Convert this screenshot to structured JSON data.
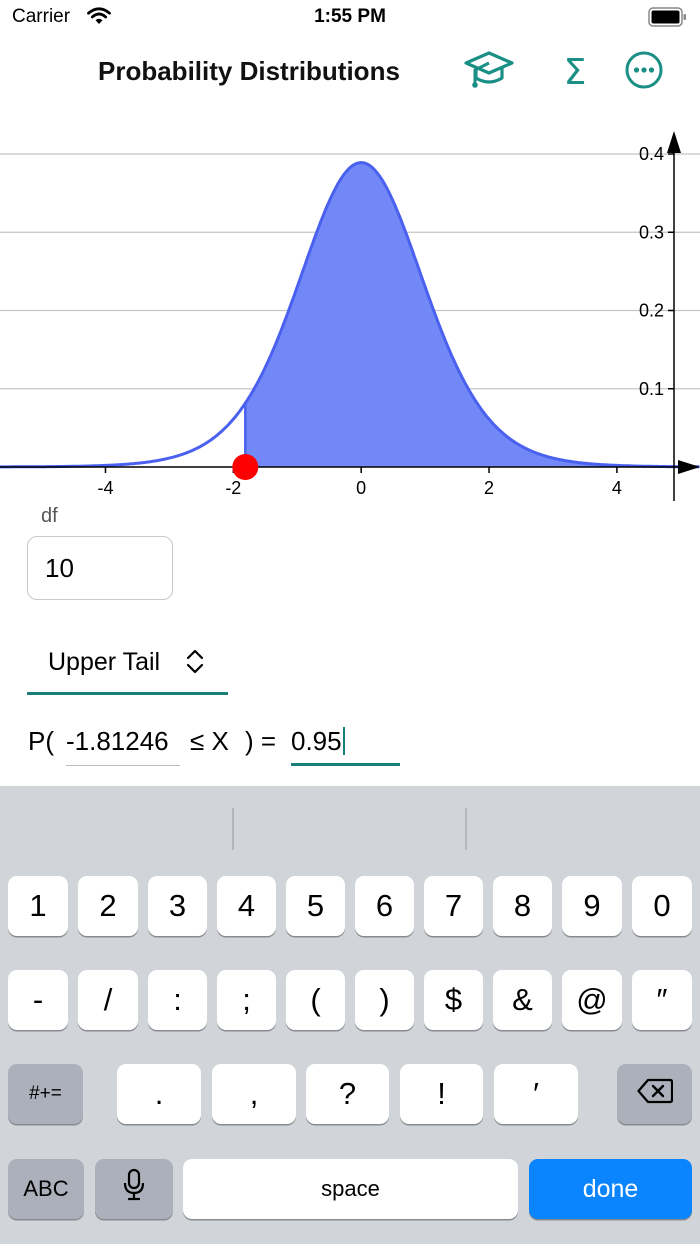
{
  "status_bar": {
    "carrier": "Carrier",
    "time": "1:55 PM"
  },
  "nav": {
    "title": "Probability Distributions",
    "icons": [
      "graduation-cap-icon",
      "sigma-icon",
      "more-icon"
    ],
    "sigma_glyph": "Σ",
    "accent_color": "#1a8f86"
  },
  "chart_data": {
    "type": "area",
    "distribution": "Student's t",
    "x_ticks": [
      "-4",
      "-2",
      "0",
      "2",
      "4"
    ],
    "y_ticks": [
      "0.1",
      "0.2",
      "0.3",
      "0.4"
    ],
    "xlim": [
      -5.65,
      5.3
    ],
    "ylim": [
      0,
      0.4
    ],
    "grid": true,
    "peak": {
      "x": 0,
      "y": 0.389
    },
    "shaded_region": {
      "from": -1.81246,
      "to": "inf"
    },
    "marker": {
      "x": -1.81246,
      "y": 0,
      "color": "#ff0000"
    },
    "fill_color": "#7388f7",
    "line_color": "#4a61ef"
  },
  "df": {
    "label": "df",
    "value": "10"
  },
  "tail": {
    "label": "Upper Tail"
  },
  "probability": {
    "prefix": "P(",
    "x_value": "-1.81246",
    "relation": "≤ X",
    "suffix": ") =",
    "p_value": "0.95"
  },
  "keyboard": {
    "row1": [
      "1",
      "2",
      "3",
      "4",
      "5",
      "6",
      "7",
      "8",
      "9",
      "0"
    ],
    "row2": [
      "-",
      "/",
      ":",
      ";",
      "(",
      ")",
      "$",
      "&",
      "@",
      "″"
    ],
    "row3": {
      "symbols": "#+=",
      "keys": [
        ".",
        ",",
        "?",
        "!",
        "′"
      ]
    },
    "row4": {
      "abc": "ABC",
      "space": "space",
      "done": "done"
    }
  }
}
